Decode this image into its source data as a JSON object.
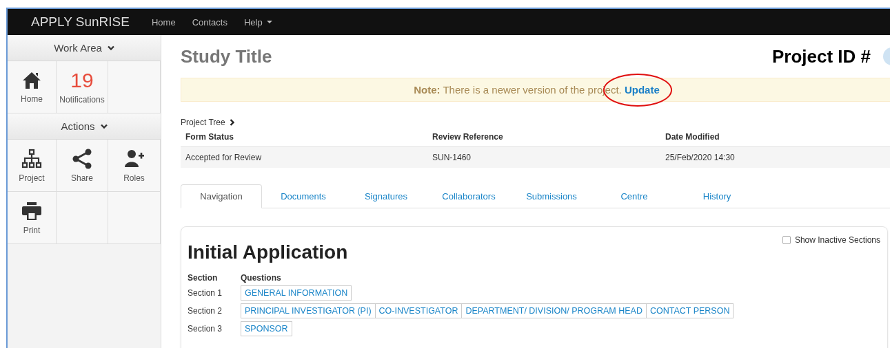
{
  "navbar": {
    "brand": "APPLY SunRISE",
    "links": [
      {
        "label": "Home",
        "kind": "link"
      },
      {
        "label": "Contacts",
        "kind": "link"
      },
      {
        "label": "Help",
        "kind": "dropdown"
      }
    ]
  },
  "sidebar": {
    "groups": [
      {
        "title": "Work Area",
        "tiles": [
          {
            "kind": "home",
            "label": "Home"
          },
          {
            "kind": "count",
            "count": "19",
            "label": "Notifications"
          },
          {
            "kind": "empty"
          }
        ]
      },
      {
        "title": "Actions",
        "tiles": [
          {
            "kind": "sitemap",
            "label": "Project"
          },
          {
            "kind": "share",
            "label": "Share"
          },
          {
            "kind": "user-plus",
            "label": "Roles"
          },
          {
            "kind": "print",
            "label": "Print"
          },
          {
            "kind": "empty"
          },
          {
            "kind": "empty"
          }
        ]
      }
    ]
  },
  "main": {
    "title": "Study Title",
    "project_id": "Project ID #",
    "alert": {
      "prefix": "Note:",
      "message": "There is a newer version of the project.",
      "link": "Update"
    },
    "breadcrumb": "Project Tree",
    "table": {
      "columns": [
        "Form Status",
        "Review Reference",
        "Date Modified"
      ],
      "rows": [
        [
          "Accepted for Review",
          "SUN-1460",
          "25/Feb/2020 14:30"
        ]
      ]
    },
    "tabs": [
      {
        "label": "Navigation",
        "selected": true
      },
      {
        "label": "Documents",
        "selected": false
      },
      {
        "label": "Signatures",
        "selected": false
      },
      {
        "label": "Collaborators",
        "selected": false
      },
      {
        "label": "Submissions",
        "selected": false
      },
      {
        "label": "Centre",
        "selected": false
      },
      {
        "label": "History",
        "selected": false
      }
    ],
    "panel": {
      "title": "Initial Application",
      "show_inactive": {
        "label": "Show Inactive Sections",
        "checked": false
      },
      "columns": [
        "Section",
        "Questions"
      ],
      "sections": [
        {
          "label": "Section 1",
          "questions": [
            "GENERAL INFORMATION"
          ]
        },
        {
          "label": "Section 2",
          "questions": [
            "PRINCIPAL INVESTIGATOR (PI)",
            "CO-INVESTIGATOR",
            "DEPARTMENT/ DIVISION/ PROGRAM HEAD",
            "CONTACT PERSON"
          ]
        },
        {
          "label": "Section 3",
          "questions": [
            "SPONSOR"
          ]
        }
      ]
    }
  }
}
